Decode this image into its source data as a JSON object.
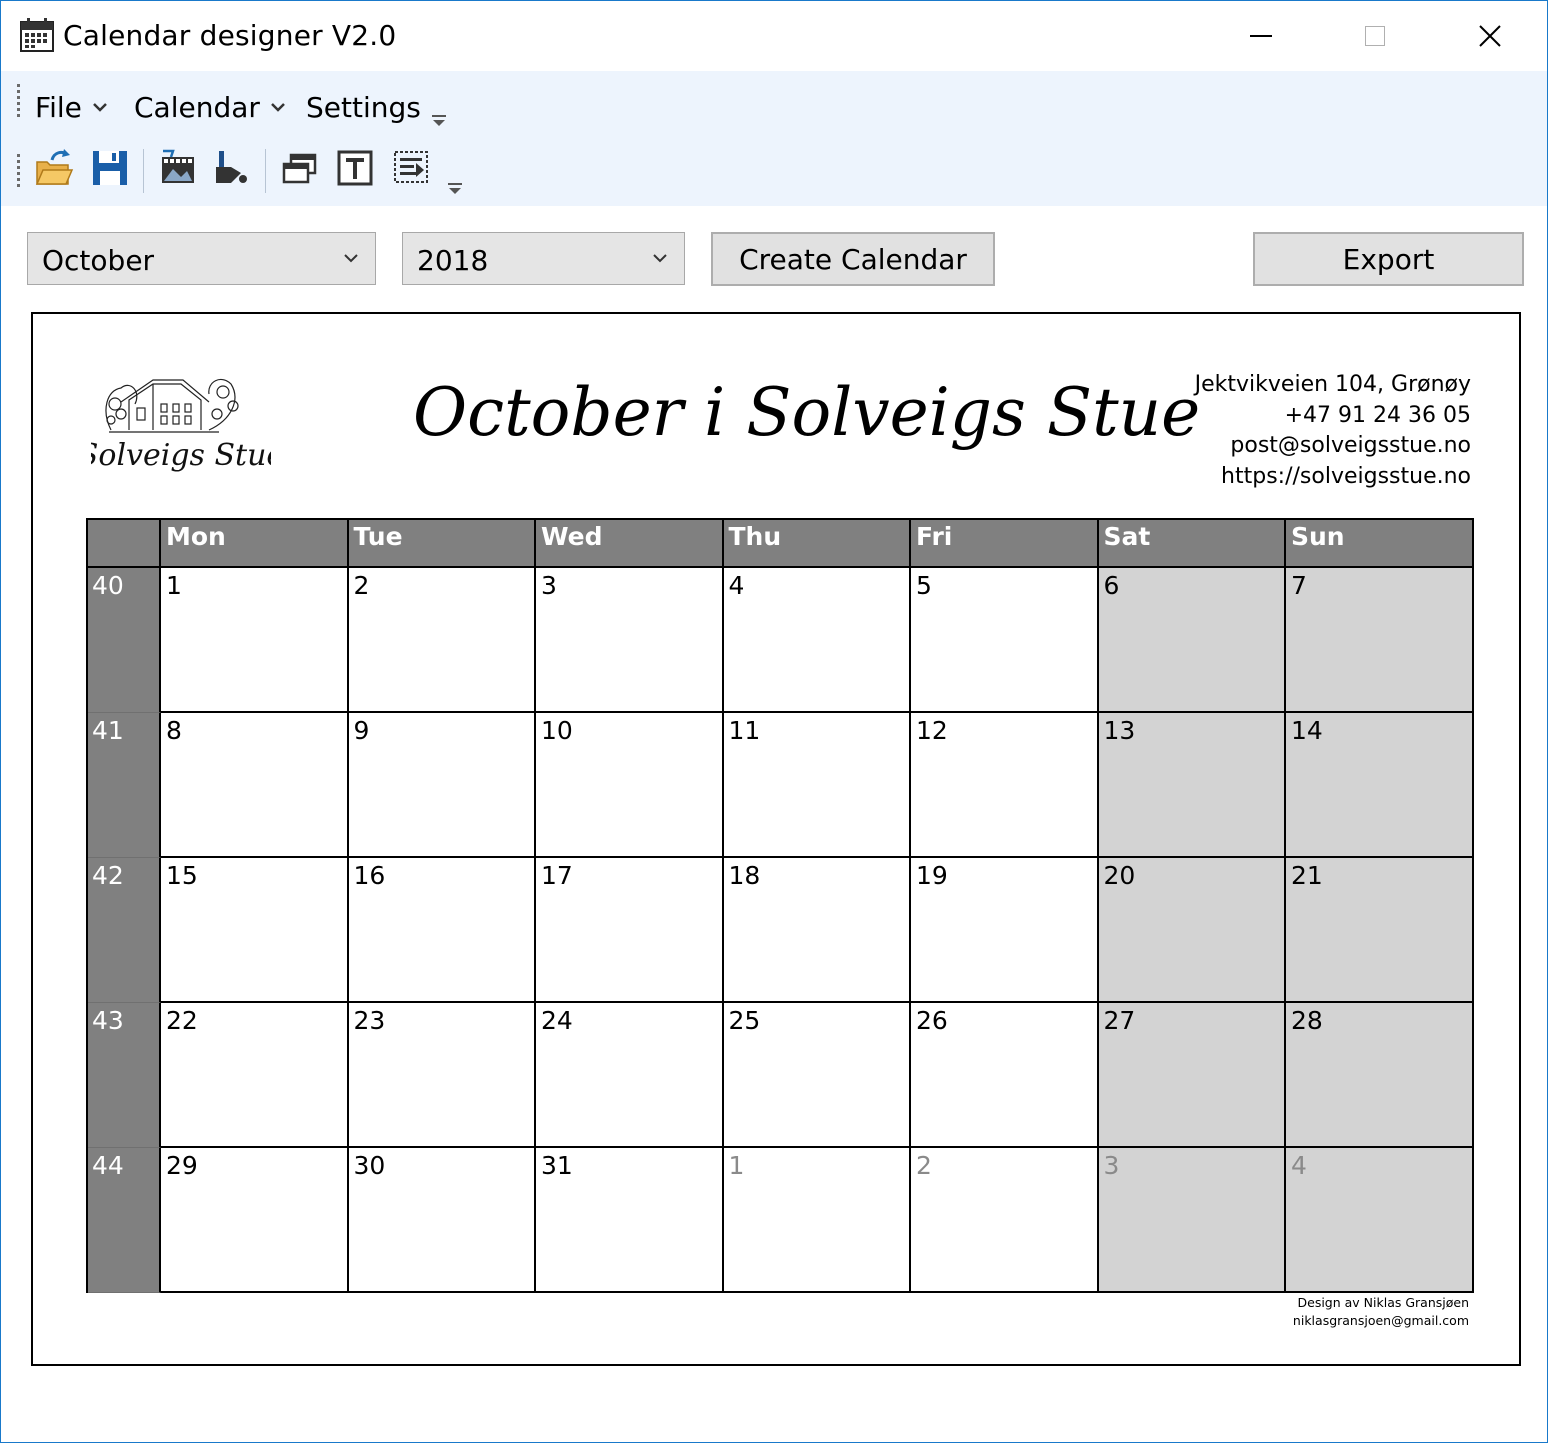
{
  "window": {
    "title": "Calendar designer V2.0",
    "controls": [
      "minimize",
      "maximize",
      "close"
    ]
  },
  "menu": {
    "items": [
      {
        "label": "File",
        "has_dropdown": true
      },
      {
        "label": "Calendar",
        "has_dropdown": true
      },
      {
        "label": "Settings",
        "has_dropdown": false
      }
    ]
  },
  "toolbar": {
    "buttons": [
      "open-folder-icon",
      "save-icon",
      "image-icon",
      "paint-icon",
      "window-icon",
      "text-box-icon",
      "replace-icon"
    ]
  },
  "controls": {
    "month_value": "October",
    "year_value": "2018",
    "create_label": "Create Calendar",
    "export_label": "Export"
  },
  "calendar": {
    "title": "October i Solveigs Stue",
    "logo_text": "Solveigs Stue",
    "contact": {
      "address": "Jektvikveien 104, Grønøy",
      "phone": "+47 91 24 36 05",
      "email": "post@solveigsstue.no",
      "url": "https://solveigsstue.no"
    },
    "day_headers": [
      "Mon",
      "Tue",
      "Wed",
      "Thu",
      "Fri",
      "Sat",
      "Sun"
    ],
    "weeks": [
      {
        "week": "40",
        "days": [
          {
            "d": "1"
          },
          {
            "d": "2"
          },
          {
            "d": "3"
          },
          {
            "d": "4"
          },
          {
            "d": "5"
          },
          {
            "d": "6"
          },
          {
            "d": "7"
          }
        ]
      },
      {
        "week": "41",
        "days": [
          {
            "d": "8"
          },
          {
            "d": "9"
          },
          {
            "d": "10"
          },
          {
            "d": "11"
          },
          {
            "d": "12"
          },
          {
            "d": "13"
          },
          {
            "d": "14"
          }
        ]
      },
      {
        "week": "42",
        "days": [
          {
            "d": "15"
          },
          {
            "d": "16"
          },
          {
            "d": "17"
          },
          {
            "d": "18"
          },
          {
            "d": "19"
          },
          {
            "d": "20"
          },
          {
            "d": "21"
          }
        ]
      },
      {
        "week": "43",
        "days": [
          {
            "d": "22"
          },
          {
            "d": "23"
          },
          {
            "d": "24"
          },
          {
            "d": "25"
          },
          {
            "d": "26"
          },
          {
            "d": "27"
          },
          {
            "d": "28"
          }
        ]
      },
      {
        "week": "44",
        "days": [
          {
            "d": "29"
          },
          {
            "d": "30"
          },
          {
            "d": "31"
          },
          {
            "d": "1",
            "other": true
          },
          {
            "d": "2",
            "other": true
          },
          {
            "d": "3",
            "other": true
          },
          {
            "d": "4",
            "other": true
          }
        ]
      }
    ],
    "footer": {
      "line1": "Design av Niklas Gransjøen",
      "line2": "niklasgransjoen@gmail.com"
    }
  },
  "colors": {
    "header_bg": "#808080",
    "weekend_bg": "#d3d3d3",
    "toolstrip_bg": "#edf4fd",
    "window_border": "#1979ca"
  }
}
